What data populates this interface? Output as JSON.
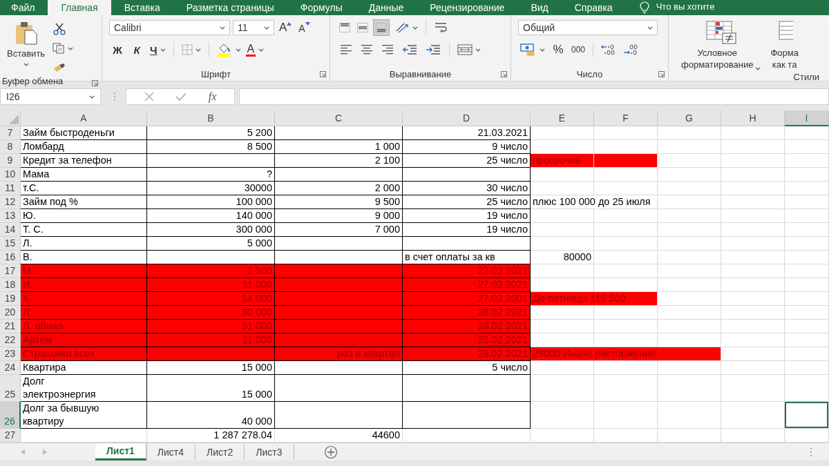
{
  "ribbon_tabs": [
    {
      "label": "Файл",
      "selected": false
    },
    {
      "label": "Главная",
      "selected": true
    },
    {
      "label": "Вставка",
      "selected": false
    },
    {
      "label": "Разметка страницы",
      "selected": false
    },
    {
      "label": "Формулы",
      "selected": false
    },
    {
      "label": "Данные",
      "selected": false
    },
    {
      "label": "Рецензирование",
      "selected": false
    },
    {
      "label": "Вид",
      "selected": false
    },
    {
      "label": "Справка",
      "selected": false
    }
  ],
  "tell_me": "Что вы хотите",
  "ribbon": {
    "clipboard": {
      "paste": "Вставить",
      "group_label": "Буфер обмена"
    },
    "font": {
      "font_name": "Calibri",
      "font_size": "11",
      "grow": "A",
      "shrink": "A",
      "bold": "Ж",
      "italic": "К",
      "underline": "Ч",
      "font_color": "A",
      "group_label": "Шрифт"
    },
    "alignment": {
      "group_label": "Выравнивание"
    },
    "number": {
      "format": "Общий",
      "percent": "%",
      "thousands": "000",
      "group_label": "Число"
    },
    "styles": {
      "conditional": "Условное\nформатирование",
      "format_table": "Форма\nкак та",
      "group_label": "Стили"
    }
  },
  "formula_bar": {
    "name_box": "I26",
    "fx": "fx"
  },
  "columns": [
    {
      "label": "A",
      "selected": false
    },
    {
      "label": "B",
      "selected": false
    },
    {
      "label": "C",
      "selected": false
    },
    {
      "label": "D",
      "selected": false
    },
    {
      "label": "E",
      "selected": false
    },
    {
      "label": "F",
      "selected": false
    },
    {
      "label": "G",
      "selected": false
    },
    {
      "label": "H",
      "selected": false
    },
    {
      "label": "I",
      "selected": true
    }
  ],
  "rows": [
    {
      "number": "7",
      "selected": false,
      "bordered": true,
      "cells": [
        {
          "kind": "text",
          "text": "Займ быстроденьги"
        },
        {
          "kind": "value",
          "text": "5 200"
        },
        {
          "kind": "empty"
        },
        {
          "kind": "value",
          "text": "21.03.2021"
        }
      ]
    },
    {
      "number": "8",
      "selected": false,
      "bordered": true,
      "cells": [
        {
          "kind": "text",
          "text": "Ломбард"
        },
        {
          "kind": "value",
          "text": "8 500"
        },
        {
          "kind": "value",
          "text": "1 000"
        },
        {
          "kind": "value",
          "text": "9 число"
        }
      ]
    },
    {
      "number": "9",
      "selected": false,
      "bordered": true,
      "cells": [
        {
          "kind": "text",
          "text": "Кредит за телефон"
        },
        {
          "kind": "empty"
        },
        {
          "kind": "value",
          "text": "2 100"
        },
        {
          "kind": "value",
          "text": "25 число"
        },
        {
          "kind": "text",
          "text": "просрочка",
          "color": "#ff0000"
        },
        {
          "kind": "empty",
          "color": "#ff0000"
        }
      ]
    },
    {
      "number": "10",
      "selected": false,
      "bordered": true,
      "cells": [
        {
          "kind": "text",
          "text": "Мама"
        },
        {
          "kind": "value",
          "text": "?"
        }
      ]
    },
    {
      "number": "11",
      "selected": false,
      "bordered": true,
      "cells": [
        {
          "kind": "text",
          "text": "т.С."
        },
        {
          "kind": "value",
          "text": "30000"
        },
        {
          "kind": "value",
          "text": "2 000"
        },
        {
          "kind": "value",
          "text": "30 число"
        }
      ]
    },
    {
      "number": "12",
      "selected": false,
      "bordered": true,
      "cells": [
        {
          "kind": "text",
          "text": "Займ под %"
        },
        {
          "kind": "value",
          "text": "100 000"
        },
        {
          "kind": "value",
          "text": "9 500"
        },
        {
          "kind": "value",
          "text": "25 число"
        },
        {
          "kind": "text",
          "text": "плюс 100 000 до 25 июля"
        }
      ]
    },
    {
      "number": "13",
      "selected": false,
      "bordered": true,
      "cells": [
        {
          "kind": "text",
          "text": "Ю."
        },
        {
          "kind": "value",
          "text": "140 000"
        },
        {
          "kind": "value",
          "text": "9 000"
        },
        {
          "kind": "value",
          "text": "19 число"
        }
      ]
    },
    {
      "number": "14",
      "selected": false,
      "bordered": true,
      "cells": [
        {
          "kind": "text",
          "text": "Т. С."
        },
        {
          "kind": "value",
          "text": "300 000"
        },
        {
          "kind": "value",
          "text": "7 000"
        },
        {
          "kind": "value",
          "text": "19 число"
        }
      ]
    },
    {
      "number": "15",
      "selected": false,
      "bordered": true,
      "cells": [
        {
          "kind": "text",
          "text": "Л."
        },
        {
          "kind": "value",
          "text": "5 000"
        }
      ]
    },
    {
      "number": "16",
      "selected": false,
      "bordered": true,
      "cells": [
        {
          "kind": "text",
          "text": "В."
        },
        {
          "kind": "empty"
        },
        {
          "kind": "empty"
        },
        {
          "kind": "text",
          "text": "в счет оплаты за кв"
        },
        {
          "kind": "value",
          "text": "80000"
        }
      ]
    },
    {
      "number": "17",
      "selected": false,
      "bordered": true,
      "cells": [
        {
          "kind": "text",
          "text": "М.",
          "color": "#ff0000"
        },
        {
          "kind": "value",
          "text": "2 500",
          "color": "#ff0000"
        },
        {
          "kind": "empty",
          "color": "#ff0000"
        },
        {
          "kind": "value",
          "text": "27.02.2021",
          "color": "#ff0000"
        }
      ]
    },
    {
      "number": "18",
      "selected": false,
      "bordered": true,
      "cells": [
        {
          "kind": "text",
          "text": "И.",
          "color": "#ff0000"
        },
        {
          "kind": "value",
          "text": "11 000",
          "color": "#ff0000"
        },
        {
          "kind": "empty",
          "color": "#ff0000"
        },
        {
          "kind": "value",
          "text": "27.02.2021",
          "color": "#ff0000"
        }
      ]
    },
    {
      "number": "19",
      "selected": false,
      "bordered": true,
      "cells": [
        {
          "kind": "text",
          "text": "К.",
          "color": "#ff0000"
        },
        {
          "kind": "value",
          "text": "14 000",
          "color": "#ff0000"
        },
        {
          "kind": "empty",
          "color": "#ff0000"
        },
        {
          "kind": "value",
          "text": "27.02.2001",
          "color": "#ff0000"
        },
        {
          "kind": "text",
          "text": "До пятницы 119 500",
          "color": "#ff0000"
        },
        {
          "kind": "empty",
          "color": "#ff0000"
        }
      ]
    },
    {
      "number": "20",
      "selected": false,
      "bordered": true,
      "cells": [
        {
          "kind": "text",
          "text": "Л.",
          "color": "#ff0000"
        },
        {
          "kind": "value",
          "text": "30 000",
          "color": "#ff0000"
        },
        {
          "kind": "empty",
          "color": "#ff0000"
        },
        {
          "kind": "value",
          "text": "28.02.2021",
          "color": "#ff0000"
        }
      ]
    },
    {
      "number": "21",
      "selected": false,
      "bordered": true,
      "cells": [
        {
          "kind": "text",
          "text": "Л. обнал",
          "color": "#ff0000"
        },
        {
          "kind": "value",
          "text": "51 000",
          "color": "#ff0000"
        },
        {
          "kind": "empty",
          "color": "#ff0000"
        },
        {
          "kind": "value",
          "text": "28.02.2021",
          "color": "#ff0000"
        }
      ]
    },
    {
      "number": "22",
      "selected": false,
      "bordered": true,
      "cells": [
        {
          "kind": "text",
          "text": "Артем",
          "color": "#ff0000"
        },
        {
          "kind": "value",
          "text": "11 000",
          "color": "#ff0000"
        },
        {
          "kind": "empty",
          "color": "#ff0000"
        },
        {
          "kind": "value",
          "text": "28.02.2021",
          "color": "#ff0000"
        }
      ]
    },
    {
      "number": "23",
      "selected": false,
      "bordered": true,
      "cells": [
        {
          "kind": "text",
          "text": "Страховки всех",
          "color": "#ff0000"
        },
        {
          "kind": "empty",
          "color": "#ff0000"
        },
        {
          "kind": "value",
          "text": "раз в квартал",
          "color": "#ff0000"
        },
        {
          "kind": "value",
          "text": "28.02.2021",
          "color": "#ff0000"
        },
        {
          "kind": "text",
          "text": "29000 Иначе расторжение",
          "color": "#ff0000"
        },
        {
          "kind": "empty",
          "color": "#ff0000"
        },
        {
          "kind": "empty",
          "color": "#ff0000"
        }
      ]
    },
    {
      "number": "24",
      "selected": false,
      "bordered": true,
      "cells": [
        {
          "kind": "text",
          "text": "Квартира"
        },
        {
          "kind": "value",
          "text": "15 000"
        },
        {
          "kind": "empty"
        },
        {
          "kind": "value",
          "text": "5 число"
        }
      ]
    },
    {
      "number": "25",
      "selected": false,
      "bordered": true,
      "cells": [
        {
          "kind": "text",
          "text": "Долг\nэлектроэнергия"
        },
        {
          "kind": "value",
          "text": "15 000"
        }
      ]
    },
    {
      "number": "26",
      "selected": true,
      "bordered": true,
      "cells": [
        {
          "kind": "text",
          "text": "Долг за бывшую\nквартиру"
        },
        {
          "kind": "value",
          "text": "40 000"
        }
      ]
    },
    {
      "number": "27",
      "selected": false,
      "bordered": false,
      "cells": [
        {
          "kind": "empty"
        },
        {
          "kind": "value",
          "text": "1 287 278.04"
        },
        {
          "kind": "value",
          "text": "44600"
        }
      ]
    }
  ],
  "sheet_tabs": [
    {
      "label": "Лист1",
      "selected": true
    },
    {
      "label": "Лист4",
      "selected": false
    },
    {
      "label": "Лист2",
      "selected": false
    },
    {
      "label": "Лист3",
      "selected": false
    }
  ]
}
